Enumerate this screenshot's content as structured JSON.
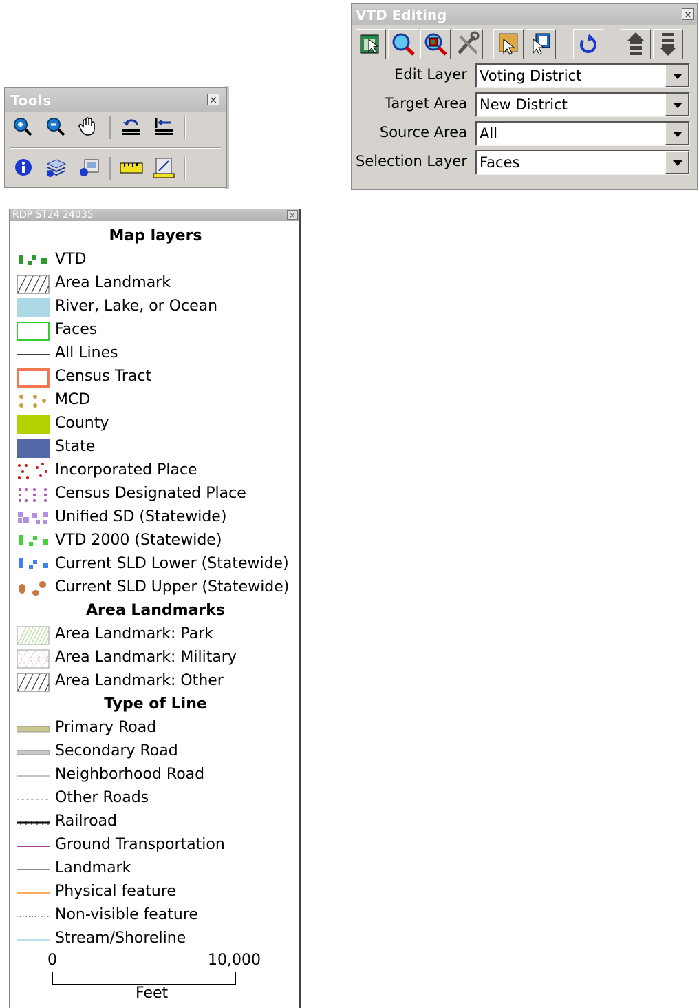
{
  "tools": {
    "title": "Tools",
    "close": "×"
  },
  "vtd": {
    "title": "VTD Editing",
    "close": "×",
    "fields": [
      {
        "label": "Edit Layer",
        "value": "Voting District"
      },
      {
        "label": "Target Area",
        "value": "New District"
      },
      {
        "label": "Source Area",
        "value": "All"
      },
      {
        "label": "Selection Layer",
        "value": "Faces"
      }
    ]
  },
  "legend": {
    "title": "RDP ST24 24035",
    "close": "×",
    "map_layers_heading": "Map layers",
    "map_layers": [
      "VTD",
      "Area Landmark",
      "River, Lake, or Ocean",
      "Faces",
      "All Lines",
      "Census Tract",
      "MCD",
      "County",
      "State",
      "Incorporated Place",
      "Census Designated Place",
      "Unified SD (Statewide)",
      "VTD 2000 (Statewide)",
      "Current SLD Lower (Statewide)",
      "Current SLD Upper (Statewide)"
    ],
    "area_landmarks_heading": "Area Landmarks",
    "area_landmarks": [
      "Area Landmark: Park",
      "Area Landmark: Military",
      "Area Landmark: Other"
    ],
    "line_heading": "Type of Line",
    "lines": [
      "Primary Road",
      "Secondary Road",
      "Neighborhood Road",
      "Other Roads",
      "Railroad",
      "Ground Transportation",
      "Landmark",
      "Physical feature",
      "Non-visible feature",
      "Stream/Shoreline"
    ],
    "scale": {
      "min": "0",
      "max": "10,000",
      "unit": "Feet"
    }
  },
  "colors": {
    "vtd": "#2e9a2e",
    "river": "#add8e6",
    "faces": "#33cc33",
    "census_tract": "#f07850",
    "mcd": "#c8a040",
    "county": "#b4d200",
    "state": "#5468a8",
    "incorporated": "#cc2020",
    "cdp": "#b050c0",
    "unified_sd": "#b090e0",
    "vtd2000": "#40d040",
    "sld_lower": "#4080f0",
    "sld_upper": "#c87840",
    "primary_road": "#c8c890",
    "physical_feature": "#ff9020",
    "ground_transport": "#800080",
    "stream": "#a0d8f0"
  }
}
